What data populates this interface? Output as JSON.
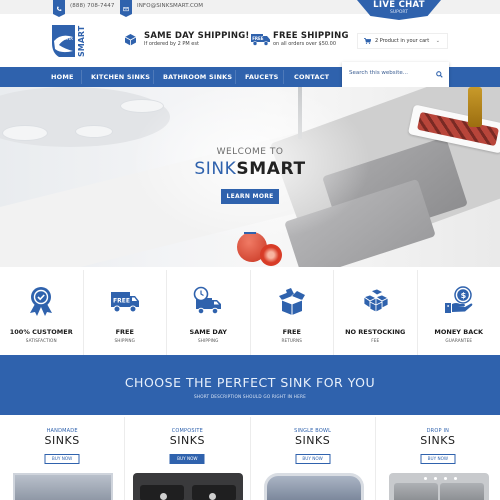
{
  "topbar": {
    "phone": "(888) 708-7447",
    "email": "INFO@SINKSMART.COM",
    "live_chat": {
      "title": "LIVE CHAT",
      "subtitle": "SUPORT"
    }
  },
  "header": {
    "logo_text": "SMART",
    "logo_script": "Sink",
    "features": [
      {
        "icon": "box-icon",
        "title": "SAME DAY SHIPPING!",
        "subtitle": "If ordered by 2 PM est"
      },
      {
        "icon": "free-truck-icon",
        "title": "FREE SHIPPING",
        "subtitle": "on all orders over $50.00"
      }
    ],
    "cart": {
      "text": "2 Product in your cart"
    }
  },
  "nav": {
    "items": [
      {
        "label": "HOME"
      },
      {
        "label": "KITCHEN SINKS"
      },
      {
        "label": "BATHROOM SINKS"
      },
      {
        "label": "FAUCETS"
      },
      {
        "label": "CONTACT"
      }
    ],
    "search_placeholder": "Search this website..."
  },
  "hero": {
    "welcome": "WELCOME TO",
    "brand_part1": "SINK",
    "brand_part2": "SMART",
    "button": "LEARN MORE"
  },
  "features": [
    {
      "icon": "award-badge-icon",
      "title": "100% CUSTOMER",
      "subtitle": "SATISFACTION"
    },
    {
      "icon": "free-truck-icon",
      "title": "FREE",
      "subtitle": "SHIPPING"
    },
    {
      "icon": "clock-truck-icon",
      "title": "SAME DAY",
      "subtitle": "SHIPPING"
    },
    {
      "icon": "open-box-icon",
      "title": "FREE",
      "subtitle": "RETURNS"
    },
    {
      "icon": "boxes-stack-icon",
      "title": "NO RESTOCKING",
      "subtitle": "FEE"
    },
    {
      "icon": "money-hand-icon",
      "title": "MONEY BACK",
      "subtitle": "GUARANTEE"
    }
  ],
  "choose": {
    "title": "CHOOSE THE PERFECT SINK FOR YOU",
    "subtitle": "SHORT DESCRIPTION SHOULD GO RIGHT IN HERE"
  },
  "products": [
    {
      "category": "HANDMADE",
      "title": "SINKS",
      "button": "BUY NOW",
      "active": false
    },
    {
      "category": "COMPOSITE",
      "title": "SINKS",
      "button": "BUY NOW",
      "active": true
    },
    {
      "category": "SINGLE BOWL",
      "title": "SINKS",
      "button": "BUY NOW",
      "active": false
    },
    {
      "category": "DROP IN",
      "title": "SINKS",
      "button": "BUY NOW",
      "active": false
    }
  ],
  "colors": {
    "brand_blue": "#2f62ad",
    "text_dark": "#1b1b1b",
    "topbar_bg": "#f1f1f1"
  }
}
